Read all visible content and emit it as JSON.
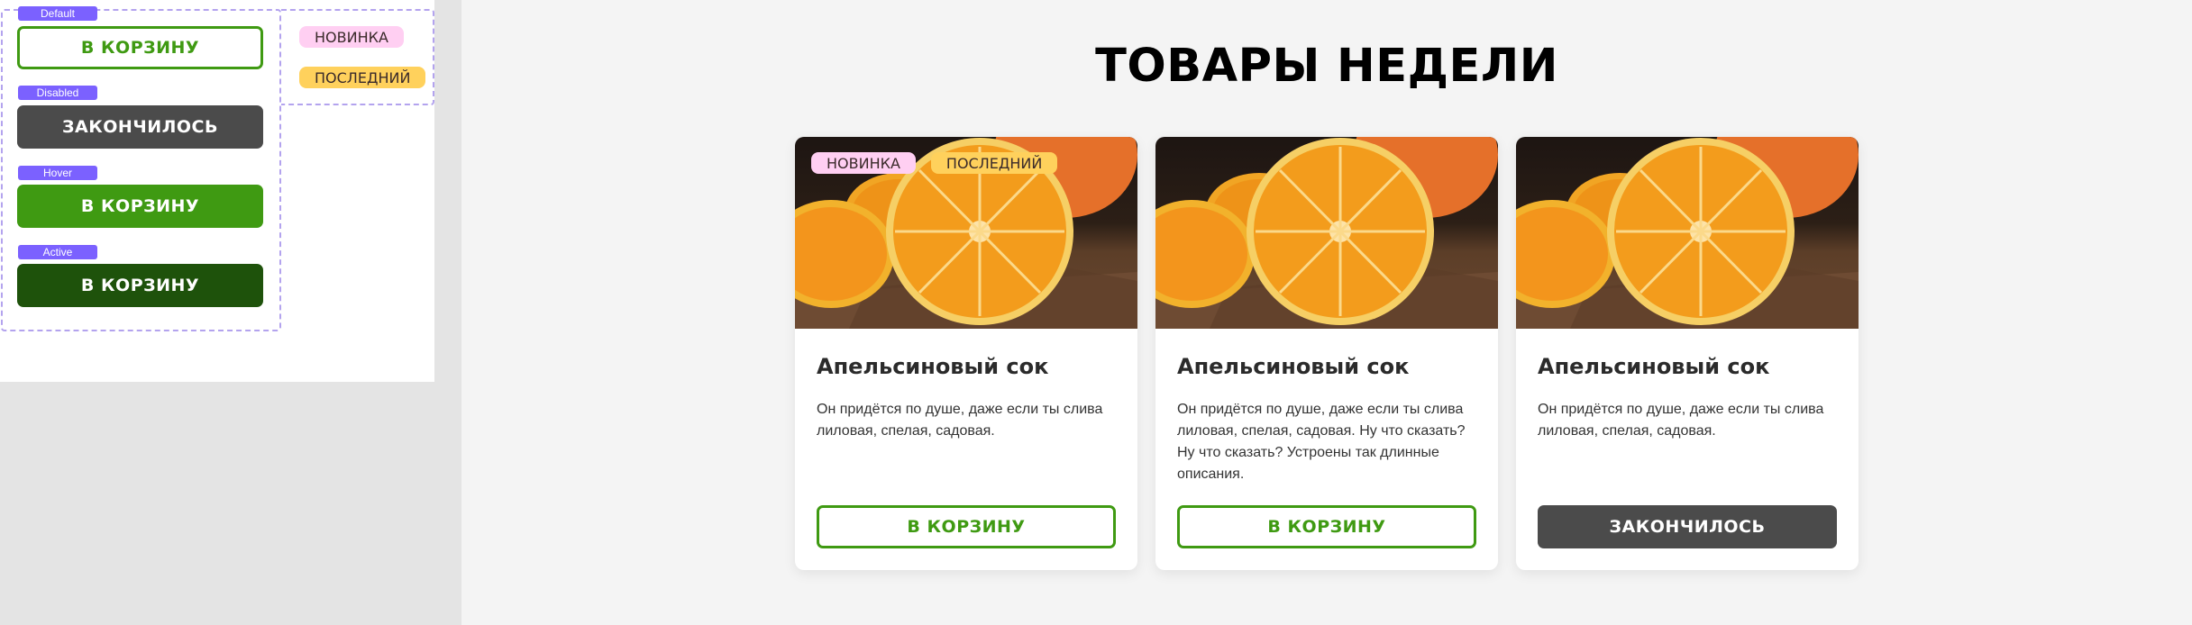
{
  "component_sheet": {
    "variants": [
      {
        "state": "Default",
        "label": "В КОРЗИНУ"
      },
      {
        "state": "Disabled",
        "label": "ЗАКОНЧИЛОСЬ"
      },
      {
        "state": "Hover",
        "label": "В КОРЗИНУ"
      },
      {
        "state": "Active",
        "label": "В КОРЗИНУ"
      }
    ],
    "badges": [
      {
        "label": "НОВИНКА",
        "color": "#ffcff2"
      },
      {
        "label": "ПОСЛЕДНИЙ",
        "color": "#ffd15c"
      }
    ]
  },
  "showcase": {
    "title": "ТОВАРЫ НЕДЕЛИ",
    "cards": [
      {
        "image": "orange-photo",
        "badges": [
          "НОВИНКА",
          "ПОСЛЕДНИЙ"
        ],
        "name": "Апельсиновый сок",
        "description": "Он придётся по душе, даже если ты слива лиловая, спелая, садовая.",
        "button_label": "В КОРЗИНУ",
        "button_state": "default"
      },
      {
        "image": "orange-photo",
        "badges": [],
        "name": "Апельсиновый сок",
        "description": "Он придётся по душе, даже если ты слива лиловая, спелая, садовая. Ну что сказать? Ну что сказать? Устроены так длинные описания.",
        "button_label": "В КОРЗИНУ",
        "button_state": "default"
      },
      {
        "image": "orange-photo",
        "badges": [],
        "name": "Апельсиновый сок",
        "description": "Он придётся по душе, даже если ты слива лиловая, спелая, садовая.",
        "button_label": "ЗАКОНЧИЛОСЬ",
        "button_state": "disabled"
      }
    ]
  },
  "colors": {
    "brand_green": "#3f9a12",
    "active_green": "#1e520b",
    "disabled_gray": "#4b4b4b",
    "variant_tag": "#7b61ff",
    "frame_dashed": "#b3a3ee"
  }
}
